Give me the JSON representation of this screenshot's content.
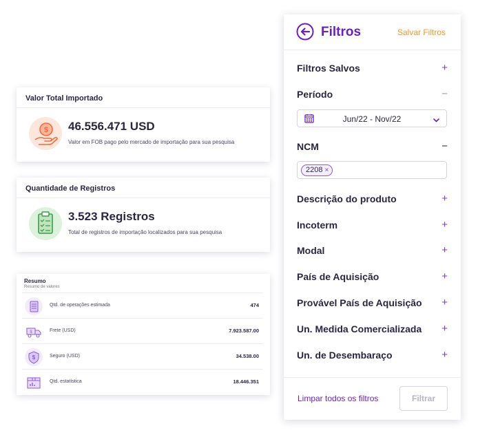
{
  "kpi_import": {
    "title": "Valor Total Importado",
    "value": "46.556.471 USD",
    "description": "Valor em FOB pago pelo mercado de importação para sua pesquisa",
    "icon": "money-hand-icon"
  },
  "kpi_records": {
    "title": "Quantidade de Registros",
    "value": "3.523 Registros",
    "description": "Total de registros de importação localizados para sua pesquisa",
    "icon": "clipboard-icon"
  },
  "summary": {
    "title": "Resumo",
    "subtitle": "Resumo de valores",
    "rows": [
      {
        "label": "Qtd. de operações estimada",
        "value": "474",
        "icon": "clipboard-list-icon"
      },
      {
        "label": "Frete (USD)",
        "value": "7.923.587.00",
        "icon": "truck-icon"
      },
      {
        "label": "Seguro (USD)",
        "value": "34.538.00",
        "icon": "shield-dollar-icon"
      },
      {
        "label": "Qtd. estatística",
        "value": "18.446.351",
        "icon": "box-chart-icon"
      }
    ]
  },
  "filters": {
    "title": "Filtros",
    "save_label": "Salvar Filtros",
    "sections": {
      "saved": {
        "label": "Filtros Salvos",
        "sign": "+"
      },
      "period": {
        "label": "Período",
        "sign": "−"
      },
      "ncm": {
        "label": "NCM",
        "sign": "−"
      },
      "description": {
        "label": "Descrição do produto",
        "sign": "+"
      },
      "incoterm": {
        "label": "Incoterm",
        "sign": "+"
      },
      "modal": {
        "label": "Modal",
        "sign": "+"
      },
      "country": {
        "label": "País de Aquisição",
        "sign": "+"
      },
      "probable_country": {
        "label": "Provável País de Aquisição",
        "sign": "+"
      },
      "unit_commercial": {
        "label": "Un. Medida Comercializada",
        "sign": "+"
      },
      "unit_clearance": {
        "label": "Un. de Desembaraço",
        "sign": "+"
      }
    },
    "period_value": "Jun/22 - Nov/22",
    "ncm_chip": "2208",
    "chip_remove": "×",
    "clear_label": "Limpar todos os filtros",
    "apply_label": "Filtrar"
  },
  "colors": {
    "brand_purple": "#6a1fc2",
    "accent_orange": "#f0962a",
    "text_dark": "#2b2540"
  }
}
